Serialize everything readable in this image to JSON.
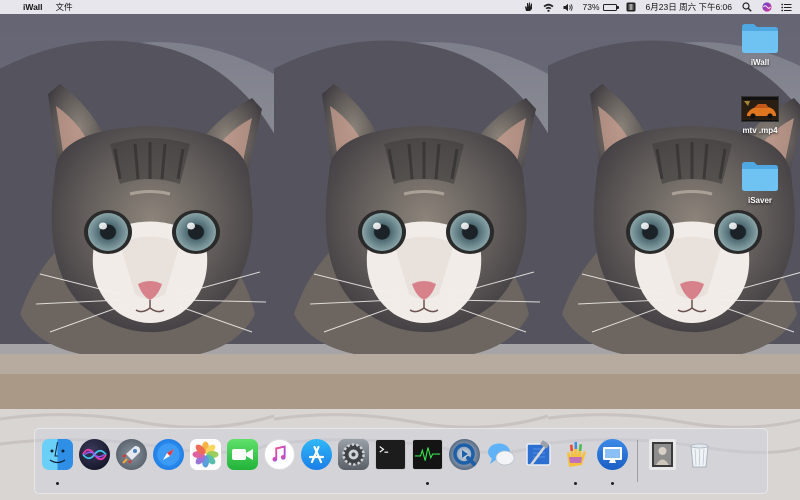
{
  "menubar": {
    "apple_glyph": "",
    "app_name": "iWall",
    "menu_file": "文件",
    "battery_percent": "73%",
    "battery_level": 0.73,
    "datetime": "6月23日 周六 下午6:06",
    "status_icons": [
      "hand-icon",
      "wifi-icon",
      "volume-icon",
      "battery-icon",
      "input-method-icon",
      "spotlight-icon",
      "siri-icon",
      "notification-center-icon"
    ]
  },
  "desktop": {
    "items": [
      {
        "label": "iWall",
        "icon": "folder-icon"
      },
      {
        "label": "mtv .mp4",
        "icon": "video-thumbnail-icon"
      },
      {
        "label": "iSaver",
        "icon": "folder-icon"
      }
    ],
    "wallpaper": "cat-photo-tiled-three-times"
  },
  "dock": {
    "apps": [
      {
        "name": "finder",
        "running": true
      },
      {
        "name": "siri",
        "running": false
      },
      {
        "name": "launchpad",
        "running": false
      },
      {
        "name": "safari",
        "running": false
      },
      {
        "name": "photos",
        "running": false
      },
      {
        "name": "facetime",
        "running": false
      },
      {
        "name": "itunes",
        "running": false
      },
      {
        "name": "app-store",
        "running": false
      },
      {
        "name": "system-preferences",
        "running": false
      },
      {
        "name": "terminal",
        "running": false
      },
      {
        "name": "activity-monitor",
        "running": true
      },
      {
        "name": "quicktime",
        "running": false
      },
      {
        "name": "messages",
        "running": false
      },
      {
        "name": "xcode",
        "running": false
      },
      {
        "name": "paint-hand",
        "running": true
      },
      {
        "name": "iwall-monitor",
        "running": true
      }
    ],
    "trailing": [
      {
        "name": "downloads-stack"
      },
      {
        "name": "trash"
      }
    ]
  },
  "colors": {
    "folder_blue": "#5fb9ee",
    "menubar_bg": "#ebebf0",
    "dock_bg": "#cdd2dc"
  }
}
